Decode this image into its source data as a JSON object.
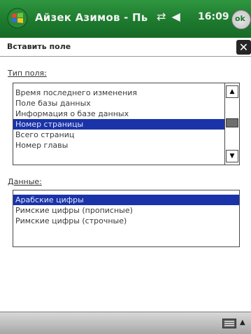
{
  "titlebar": {
    "title": "Айзек Азимов - Пь",
    "clock": "16:09",
    "ok_label": "ok",
    "icons": [
      "windows-start-icon",
      "connectivity-icon",
      "volume-icon"
    ]
  },
  "dialog": {
    "title": "Вставить поле",
    "close_glyph": "✕"
  },
  "field_type": {
    "label": "Тип поля:",
    "items": [
      {
        "label": "Время последнего изменения",
        "selected": false
      },
      {
        "label": "Поле базы данных",
        "selected": false
      },
      {
        "label": "Информация о базе данных",
        "selected": false
      },
      {
        "label": "Номер страницы",
        "selected": true
      },
      {
        "label": "Всего страниц",
        "selected": false
      },
      {
        "label": "Номер главы",
        "selected": false
      }
    ]
  },
  "data_section": {
    "label": "Данные:",
    "items": [
      {
        "label": "Арабские цифры",
        "selected": true
      },
      {
        "label": "Римские цифры (прописные)",
        "selected": false
      },
      {
        "label": "Римские цифры (строчные)",
        "selected": false
      }
    ]
  },
  "colors": {
    "titlebar": "#1d7a2e",
    "selection": "#1b33a8"
  }
}
